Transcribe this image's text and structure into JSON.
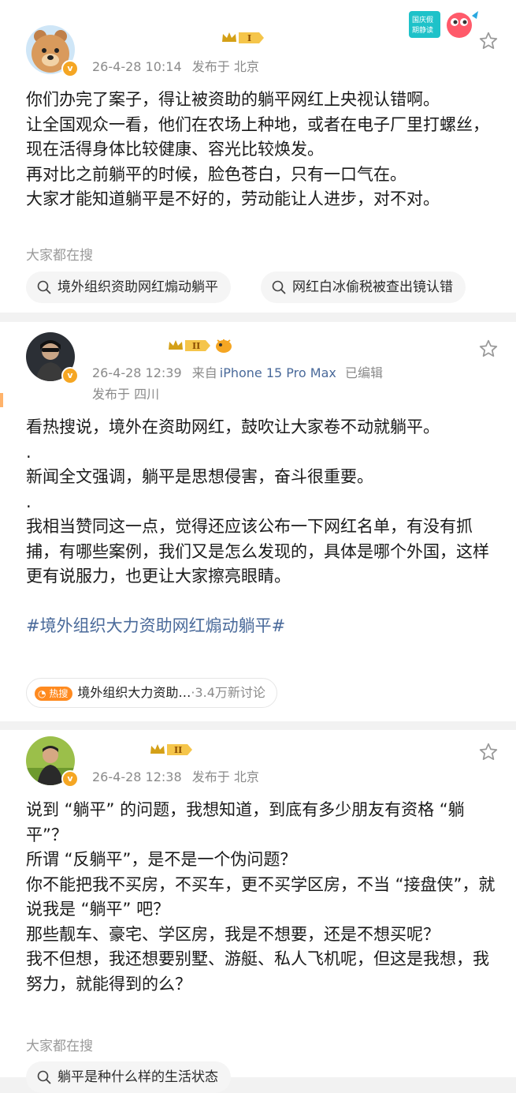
{
  "posts": [
    {
      "time": "26-4-28 10:14",
      "source": "",
      "edited": "",
      "location": "发布于 北京",
      "level_label": "I",
      "paragraphs": [
        "你们办完了案子，得让被资助的躺平网红上央视认错啊。",
        "让全国观众一看，他们在农场上种地，或者在电子厂里打螺丝，现在活得身体比较健康、容光比较焕发。",
        "再对比之前躺平的时候，脸色苍白，只有一口气在。",
        "大家才能知道躺平是不好的，劳动能让人进步，对不对。"
      ],
      "search_title": "大家都在搜",
      "search_chips": [
        "境外组织资助网红煽动躺平",
        "网红白冰偷税被查出镜认错"
      ]
    },
    {
      "time": "26-4-28 12:39",
      "source_prefix": "来自",
      "source": "iPhone 15 Pro Max",
      "edited": "已编辑",
      "location": "发布于 四川",
      "level_label": "II",
      "paragraphs": [
        "看热搜说，境外在资助网红，鼓吹让大家卷不动就躺平。",
        ".",
        "新闻全文强调，躺平是思想侵害，奋斗很重要。",
        ".",
        "我相当赞同这一点，觉得还应该公布一下网红名单，有没有抓捕，有哪些案例，我们又是怎么发现的，具体是哪个外国，这样更有说服力，也更让大家擦亮眼睛。"
      ],
      "hashtag": "#境外组织大力资助网红煽动躺平#",
      "hot": {
        "badge": "热搜",
        "topic": "境外组织大力资助…",
        "count": "·3.4万新讨论"
      }
    },
    {
      "time": "26-4-28 12:38",
      "location": "发布于 北京",
      "level_label": "II",
      "paragraphs": [
        "说到 “躺平” 的问题，我想知道，到底有多少朋友有资格 “躺平”？",
        "所谓 “反躺平”，是不是一个伪问题？",
        "你不能把我不买房，不买车，更不买学区房，不当 “接盘侠”，就说我是 “躺平” 吧？",
        "那些靓车、豪宅、学区房，我是不想要，还是不想买呢？",
        "我不但想，我还想要别墅、游艇、私人飞机呢，但这是我想，我努力，就能得到的么？"
      ],
      "search_title": "大家都在搜",
      "search_chips": [
        "躺平是种什么样的生活状态"
      ]
    }
  ],
  "sticker_text": "国庆假期静读",
  "colors": {
    "accent_blue": "#4a6a9a",
    "vip_orange": "#f5a623",
    "hot_orange": "#ff8a1f"
  }
}
